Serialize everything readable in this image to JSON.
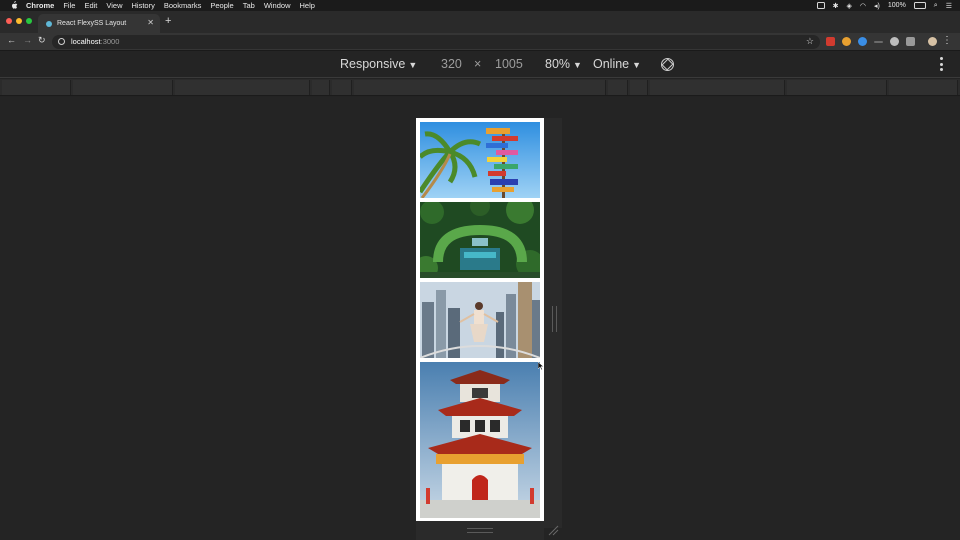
{
  "menubar": {
    "app_name": "Chrome",
    "items": [
      "File",
      "Edit",
      "View",
      "History",
      "Bookmarks",
      "People",
      "Tab",
      "Window",
      "Help"
    ],
    "battery": "100%"
  },
  "tab": {
    "title": "React FlexySS Layout"
  },
  "address": {
    "host": "localhost",
    "port": ":3000"
  },
  "device_toolbar": {
    "device": "Responsive",
    "width": "320",
    "times": "×",
    "height": "1005",
    "zoom": "80%",
    "network": "Online"
  },
  "colors": {
    "traffic_red": "#fe5f57",
    "traffic_yellow": "#febc2e",
    "traffic_green": "#28c840"
  },
  "photos": [
    {
      "name": "tropical-signpost-photo"
    },
    {
      "name": "garden-building-aerial-photo"
    },
    {
      "name": "city-skyline-woman-photo"
    },
    {
      "name": "pagoda-photo"
    }
  ]
}
